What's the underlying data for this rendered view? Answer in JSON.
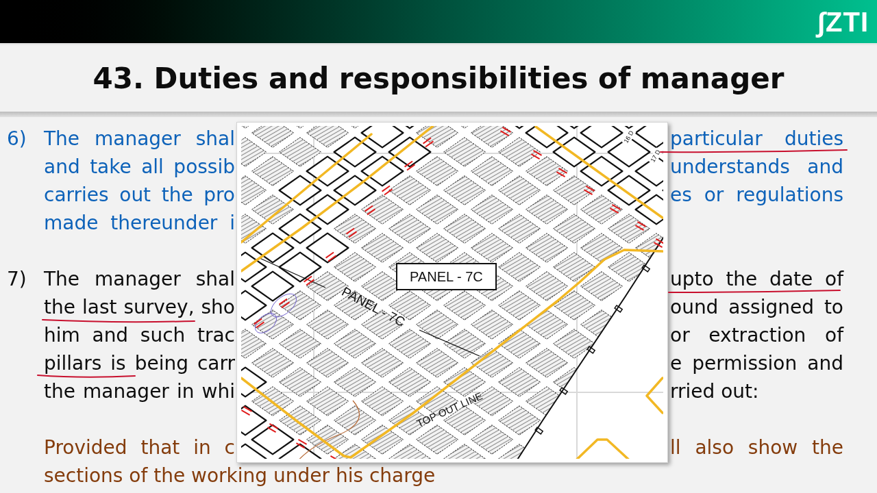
{
  "header": {
    "logo": "∫ZTI"
  },
  "title": "43. Duties and responsibilities of manager",
  "paragraphs": [
    {
      "number": "6)",
      "color": "#0d62b9",
      "lines": [
        {
          "kind": "split",
          "left": "The manager shal",
          "right": "particular duties"
        },
        {
          "kind": "split",
          "left": "and take all possib",
          "right": "understands and"
        },
        {
          "kind": "split",
          "left": "carries out the pro",
          "right": "es or regulations"
        },
        {
          "kind": "split",
          "left": "made thereunder i"
        }
      ]
    },
    {
      "number": "7)",
      "color": "#0d0d0d",
      "lines": [
        {
          "kind": "split",
          "left": "The manager shal",
          "right": "upto the date of"
        },
        {
          "kind": "split",
          "left": "the last survey, sho",
          "right": "ound assigned to"
        },
        {
          "kind": "split",
          "left": "him and such trac",
          "right": "or extraction of"
        },
        {
          "kind": "split",
          "left": "pillars is being carr",
          "right": "e permission and"
        },
        {
          "kind": "split",
          "left": "the manager in whi",
          "right": "rried out:"
        }
      ]
    },
    {
      "color": "#843c0c",
      "lines": [
        {
          "kind": "split",
          "left": "Provided that in c",
          "right": "ll also show the"
        },
        {
          "kind": "full",
          "text": "sections of the working under his charge"
        }
      ]
    }
  ],
  "map": {
    "labels": [
      {
        "kind": "boxed",
        "text": "PANEL - 7C"
      },
      {
        "kind": "rotated",
        "text": "PANEL - 7C"
      },
      {
        "kind": "rotated",
        "text": "TOP OUT LINE"
      },
      {
        "kind": "rotated",
        "text": "16 D"
      },
      {
        "kind": "rotated",
        "text": "17 D"
      }
    ]
  }
}
